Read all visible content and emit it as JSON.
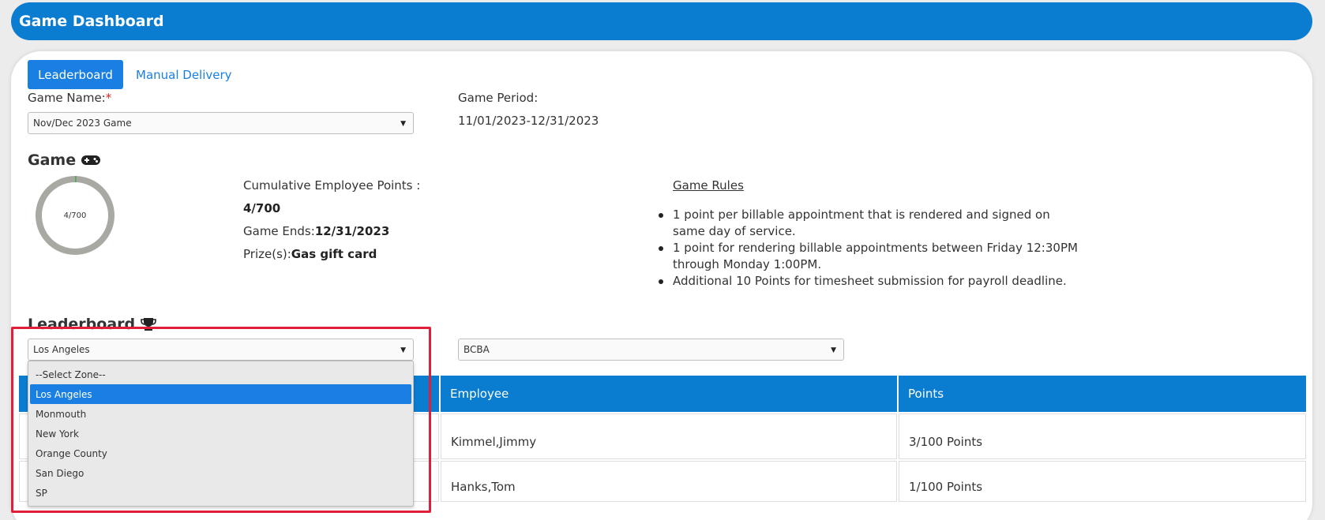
{
  "header": {
    "title": "Game Dashboard"
  },
  "tabs": {
    "active": "Leaderboard",
    "other": "Manual Delivery"
  },
  "game_name": {
    "label": "Game Name:",
    "required_mark": "*",
    "selected": "Nov/Dec 2023 Game"
  },
  "game_period": {
    "label": "Game Period:",
    "value": "11/01/2023-12/31/2023"
  },
  "game_section": {
    "heading": "Game",
    "progress_text": "4/700",
    "progress_fraction": 0.0057,
    "cumulative_label": "Cumulative Employee Points :",
    "cumulative_value": "4/700",
    "ends_label": "Game Ends:",
    "ends_value": "12/31/2023",
    "prize_label": "Prize(s):",
    "prize_value": "Gas gift card"
  },
  "rules": {
    "title": "Game Rules",
    "items": [
      "1 point per billable appointment that is rendered and signed on same day of service.",
      "1 point for rendering billable appointments between Friday 12:30PM through Monday 1:00PM.",
      "Additional 10 Points for timesheet submission for payroll deadline."
    ]
  },
  "leaderboard": {
    "heading": "Leaderboard",
    "zone_selected": "Los Angeles",
    "role_selected": "BCBA",
    "zone_options": [
      "--Select Zone--",
      "Los Angeles",
      "Monmouth",
      "New York",
      "Orange County",
      "San Diego",
      "SP"
    ],
    "zone_highlighted_index": 1,
    "columns": [
      "",
      "Employee",
      "Points"
    ],
    "rows": [
      {
        "rank": "",
        "employee": "Kimmel,Jimmy",
        "points": "3/100 Points"
      },
      {
        "rank": "",
        "employee": "Hanks,Tom",
        "points": "1/100 Points"
      }
    ]
  },
  "colors": {
    "brand": "#0b7dd1",
    "tab_active": "#1a7fe2",
    "progress_track": "#a9a9a4",
    "progress_fill": "#4caf50",
    "highlight_box": "#e01e37"
  }
}
